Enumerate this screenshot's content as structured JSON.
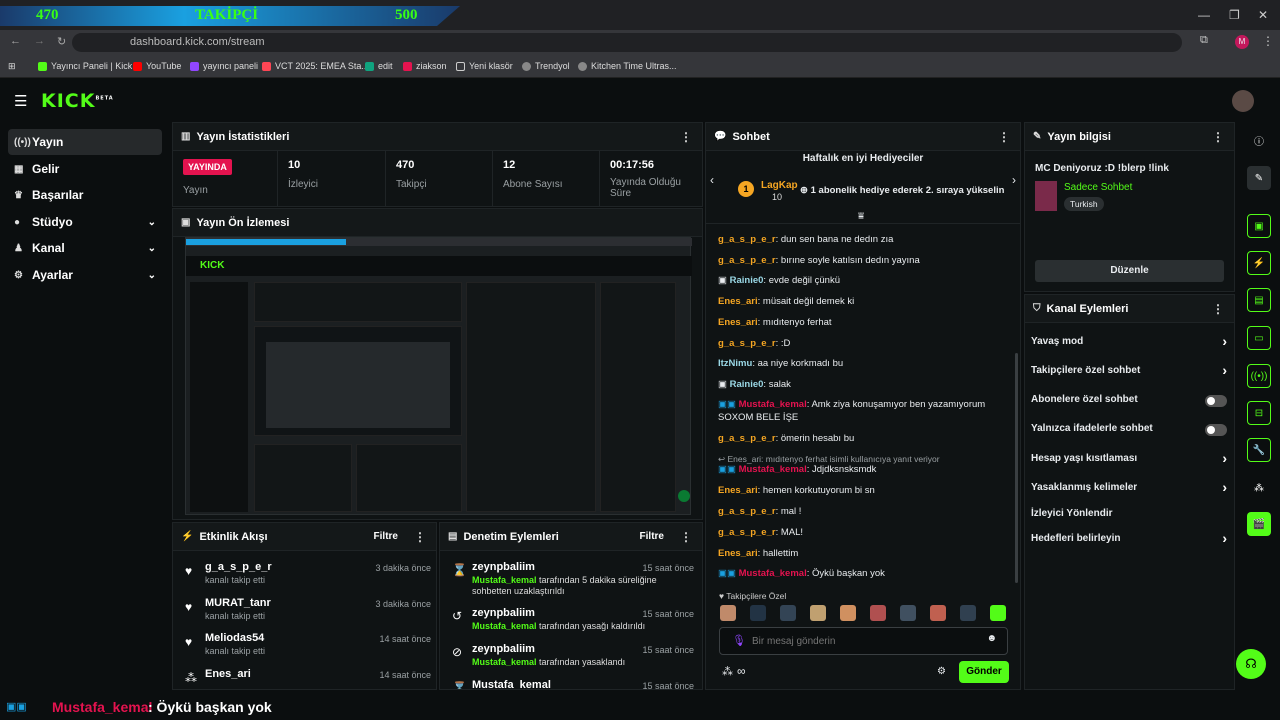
{
  "overlay": {
    "left": "470",
    "center": "TAKİPÇİ",
    "right": "500"
  },
  "browser": {
    "url": "dashboard.kick.com/stream"
  },
  "bookmarks": [
    "Yayıncı Paneli | Kick",
    "YouTube",
    "yayıncı paneli",
    "VCT 2025: EMEA Sta...",
    "edit",
    "ziakson",
    "Yeni klasör",
    "Trendyol",
    "Kitchen Time Ultras..."
  ],
  "brand": {
    "logo": "KICK",
    "beta": "BETA"
  },
  "sidebar": {
    "items": [
      {
        "label": "Yayın"
      },
      {
        "label": "Gelir"
      },
      {
        "label": "Başarılar"
      },
      {
        "label": "Stüdyo"
      },
      {
        "label": "Kanal"
      },
      {
        "label": "Ayarlar"
      }
    ]
  },
  "stats": {
    "title": "Yayın İstatistikleri",
    "live_badge": "YAYINDA",
    "items": [
      {
        "value": "",
        "label": "Yayın"
      },
      {
        "value": "10",
        "label": "İzleyici"
      },
      {
        "value": "470",
        "label": "Takipçi"
      },
      {
        "value": "12",
        "label": "Abone Sayısı"
      },
      {
        "value": "00:17:56",
        "label": "Yayında Olduğu Süre"
      }
    ]
  },
  "preview": {
    "title": "Yayın Ön İzlemesi"
  },
  "activity": {
    "title": "Etkinlik Akışı",
    "filter": "Filtre",
    "items": [
      {
        "name": "g_a_s_p_e_r",
        "sub": "kanalı takip etti",
        "time": "3 dakika önce"
      },
      {
        "name": "MURAT_tanr",
        "sub": "kanalı takip etti",
        "time": "3 dakika önce"
      },
      {
        "name": "Meliodas54",
        "sub": "kanalı takip etti",
        "time": "14 saat önce"
      },
      {
        "name": "Enes_ari",
        "sub": "",
        "time": "14 saat önce"
      }
    ]
  },
  "moderation": {
    "title": "Denetim Eylemleri",
    "filter": "Filtre",
    "items": [
      {
        "name": "zeynpbaliim",
        "actor": "Mustafa_kemal",
        "text": "tarafından 5 dakika süreliğine sohbetten uzaklaştırıldı",
        "time": "15 saat önce"
      },
      {
        "name": "zeynpbaliim",
        "actor": "Mustafa_kemal",
        "text": "tarafından yasağı kaldırıldı",
        "time": "15 saat önce"
      },
      {
        "name": "zeynpbaliim",
        "actor": "Mustafa_kemal",
        "text": "tarafından yasaklandı",
        "time": "15 saat önce"
      },
      {
        "name": "Mustafa_kemal",
        "actor": "",
        "text": "",
        "time": "15 saat önce"
      }
    ]
  },
  "chat": {
    "title": "Sohbet",
    "gifters_title": "Haftalık en iyi Hediyeciler",
    "gifter": {
      "rank": "1",
      "name": "LagKap",
      "count": "10",
      "message": "1 abonelik hediye ederek 2. sıraya yükselin"
    },
    "reply_note": "Enes_ari: mıdıtenyo ferhat isimli kullanıcıya yanıt veriyor",
    "messages": [
      {
        "user": "g_a_s_p_e_r",
        "text": ": dun sen bana ne dedın zıa",
        "color": "#f5a623"
      },
      {
        "user": "g_a_s_p_e_r",
        "text": ": bırıne soyle katılsın dedın yayına",
        "color": "#f5a623"
      },
      {
        "user": "Rainie0",
        "text": ": evde değil çünkü",
        "color": "#9ad8e6"
      },
      {
        "user": "Enes_ari",
        "text": ": müsait değil demek ki",
        "color": "#f5a623"
      },
      {
        "user": "Enes_ari",
        "text": ": mıdıtenyo ferhat",
        "color": "#f5a623"
      },
      {
        "user": "g_a_s_p_e_r",
        "text": ": :D",
        "color": "#f5a623"
      },
      {
        "user": "ItzNimu",
        "text": ": aa niye korkmadı bu",
        "color": "#9ad8e6"
      },
      {
        "user": "Rainie0",
        "text": ": salak",
        "color": "#9ad8e6"
      },
      {
        "user": "Mustafa_kemal",
        "text": ": Amk ziya konuşamıyor ben yazamıyorum SOXOM BELE İŞE",
        "color": "#e4134f"
      },
      {
        "user": "g_a_s_p_e_r",
        "text": ": ömerin hesabı bu",
        "color": "#f5a623"
      },
      {
        "user": "Mustafa_kemal",
        "text": ": Jdjdksnsksmdk",
        "color": "#e4134f"
      },
      {
        "user": "Enes_ari",
        "text": ": hemen korkutuyorum bi sn",
        "color": "#f5a623"
      },
      {
        "user": "g_a_s_p_e_r",
        "text": ": mal !",
        "color": "#f5a623"
      },
      {
        "user": "g_a_s_p_e_r",
        "text": ": MAL!",
        "color": "#f5a623"
      },
      {
        "user": "Enes_ari",
        "text": ": hallettim",
        "color": "#f5a623"
      },
      {
        "user": "Mustafa_kemal",
        "text": ": Öykü başkan yok",
        "color": "#e4134f"
      }
    ],
    "followers_only": "Takipçilere Özel",
    "input_placeholder": "Bir mesaj gönderin",
    "send": "Gönder"
  },
  "stream_info": {
    "title": "Yayın bilgisi",
    "stream_title": "MC Deniyoruz :D !blerp !link",
    "category": "Sadece Sohbet",
    "tag": "Turkish",
    "edit": "Düzenle"
  },
  "channel_actions": {
    "title": "Kanal Eylemleri",
    "items": [
      {
        "label": "Yavaş mod",
        "kind": "chevron"
      },
      {
        "label": "Takipçilere özel sohbet",
        "kind": "chevron"
      },
      {
        "label": "Abonelere özel sohbet",
        "kind": "toggle"
      },
      {
        "label": "Yalnızca ifadelerle sohbet",
        "kind": "toggle"
      },
      {
        "label": "Hesap yaşı kısıtlaması",
        "kind": "chevron"
      },
      {
        "label": "Yasaklanmış kelimeler",
        "kind": "chevron"
      },
      {
        "label": "İzleyici Yönlendir",
        "kind": "none"
      },
      {
        "label": "Hedefleri belirleyin",
        "kind": "chevron"
      }
    ]
  },
  "ticker": {
    "user": "Mustafa_kemal",
    "text": ": Öykü başkan yok"
  },
  "colors": {
    "accent": "#53fc18",
    "live": "#e4134f",
    "username_gold": "#f5a623"
  }
}
